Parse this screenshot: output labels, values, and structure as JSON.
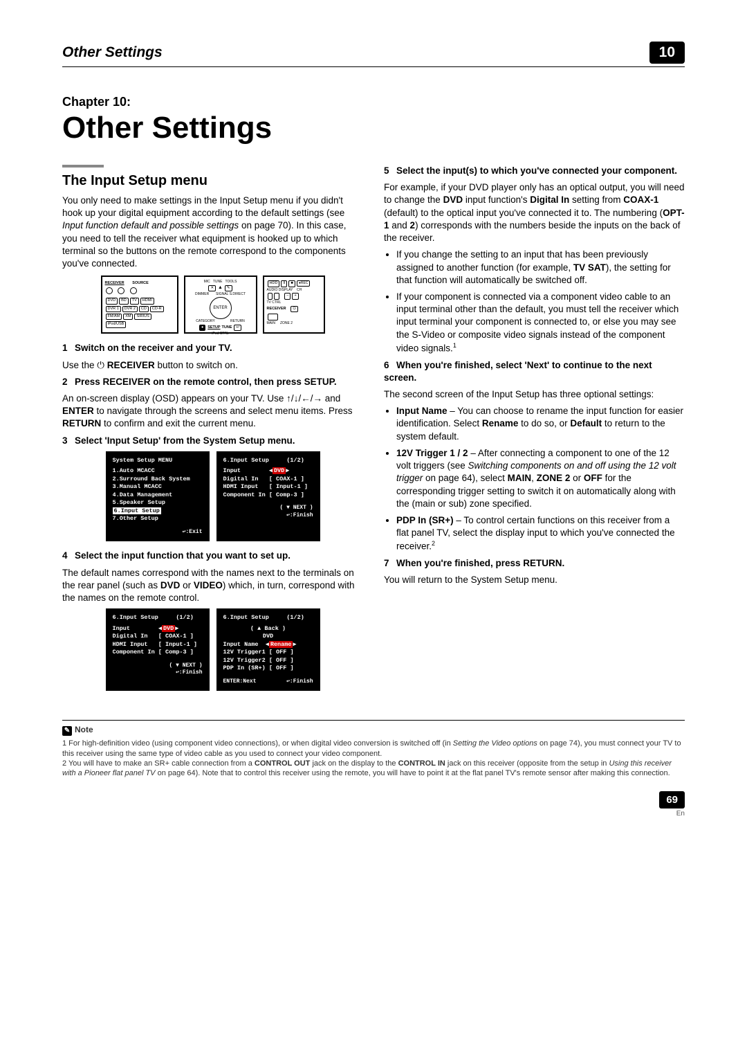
{
  "header": {
    "running_title": "Other Settings",
    "chapter_number": "10"
  },
  "chapter": {
    "label": "Chapter 10:",
    "title": "Other Settings"
  },
  "section_title": "The Input Setup menu",
  "intro": {
    "p1a": "You only need to make settings in the Input Setup menu if you didn't hook up your digital equipment according to the default settings (see ",
    "p1b": "Input function default and possible settings",
    "p1c": " on page 70). In this case, you need to tell the receiver what equipment is hooked up to which terminal so the buttons on the remote correspond to the components you've connected."
  },
  "steps": {
    "s1": "Switch on the receiver and your TV.",
    "s1a": "Use the ",
    "s1b": " RECEIVER",
    "s1c": " button to switch on.",
    "s2": "Press RECEIVER on the remote control, then press SETUP.",
    "s2a": "An on-screen display (OSD) appears on your TV. Use ",
    "s2b": " and ",
    "s2c": "ENTER",
    "s2d": " to navigate through the screens and select menu items. Press ",
    "s2e": "RETURN",
    "s2f": " to confirm and exit the current menu.",
    "s3": "Select 'Input Setup' from the System Setup menu.",
    "s4": "Select the input function that you want to set up.",
    "s4a": "The default names correspond with the names next to the terminals on the rear panel (such as ",
    "s4b": "DVD",
    "s4c": " or ",
    "s4d": "VIDEO",
    "s4e": ") which, in turn, correspond with the names on the remote control.",
    "s5": "Select the input(s) to which you've connected your component.",
    "s5a": "For example, if your DVD player only has an optical output, you will need to change the ",
    "s5b": "DVD",
    "s5c": " input function's ",
    "s5d": "Digital In",
    "s5e": " setting from ",
    "s5f": "COAX-1",
    "s5g": " (default) to the optical input you've connected it to. The numbering (",
    "s5h": "OPT-1",
    "s5i": " and ",
    "s5j": "2",
    "s5k": ") corresponds with the numbers beside the inputs on the back of the receiver.",
    "bul1a": "If you change the setting to an input that has been previously assigned to another function (for example, ",
    "bul1b": "TV SAT",
    "bul1c": "), the setting for that function will automatically be switched off.",
    "bul2": "If your component is connected via a component video cable to an input terminal other than the default, you must tell the receiver which input terminal your component is connected to, or else you may see the S-Video or composite video signals instead of the component video signals.",
    "s6": "When you're finished, select 'Next' to continue to the next screen.",
    "s6a": "The second screen of the Input Setup has three optional settings:",
    "bul3a": "Input Name",
    "bul3b": " – You can choose to rename the input function for easier identification. Select ",
    "bul3c": "Rename",
    "bul3d": " to do so, or ",
    "bul3e": "Default",
    "bul3f": " to return to the system default.",
    "bul4a": "12V Trigger 1 / 2",
    "bul4b": " – After connecting a component to one of the 12 volt triggers (see ",
    "bul4c": "Switching components on and off using the 12 volt trigger",
    "bul4d": " on page 64), select ",
    "bul4e": "MAIN",
    "bul4f": ", ",
    "bul4g": "ZONE 2",
    "bul4h": " or ",
    "bul4i": "OFF",
    "bul4j": " for the corresponding trigger setting to switch it on automatically along with the (main or sub) zone specified.",
    "bul5a": "PDP In (SR+)",
    "bul5b": " – To control certain functions on this receiver from a flat panel TV, select the display input to which you've connected the receiver.",
    "s7": "When you're finished, press RETURN.",
    "s7a": "You will return to the System Setup menu."
  },
  "osd1": {
    "title": "System Setup MENU",
    "items": [
      "1.Auto MCACC",
      "2.Surround Back System",
      "3.Manual MCACC",
      "4.Data Management",
      "5.Speaker Setup",
      "6.Input Setup",
      "7.Other Setup"
    ],
    "foot": ":Exit"
  },
  "osd2": {
    "title": "6.Input Setup",
    "page": "(1/2)",
    "rows": [
      {
        "k": "Input",
        "v": "DVD",
        "hl": true
      },
      {
        "k": "Digital In",
        "v": "COAX-1"
      },
      {
        "k": "HDMI Input",
        "v": "Input-1"
      },
      {
        "k": "Component In",
        "v": "Comp-3"
      }
    ],
    "next": "( ▼ NEXT )",
    "foot": ":Finish"
  },
  "osd3": {
    "title": "6.Input Setup",
    "page": "(1/2)",
    "rows": [
      {
        "k": "Input",
        "v": "DVD",
        "hl": true
      },
      {
        "k": "Digital In",
        "v": "COAX-1"
      },
      {
        "k": "HDMI Input",
        "v": "Input-1"
      },
      {
        "k": "Component In",
        "v": "Comp-3"
      }
    ],
    "next": "( ▼ NEXT )",
    "foot": ":Finish"
  },
  "osd4": {
    "title": "6.Input Setup",
    "page": "(1/2)",
    "back": "( ▲ Back )",
    "dvd": "DVD",
    "rows": [
      {
        "k": "Input Name",
        "v": "Rename",
        "hl": true
      },
      {
        "k": "12V Trigger1",
        "v": "OFF"
      },
      {
        "k": "12V Trigger2",
        "v": "OFF"
      },
      {
        "k": "PDP In (SR+)",
        "v": "OFF"
      }
    ],
    "enter": "ENTER:Next",
    "foot": ":Finish"
  },
  "remote_labels": {
    "receiver": "RECEIVER",
    "source": "SOURCE",
    "dvd": "DVD",
    "bd": "BD",
    "tv": "TV",
    "hdmi": "HDMI",
    "dvr1": "DVR 1",
    "dvr2": "DVR 2",
    "cd": "CD",
    "cdr": "CD-R",
    "fmam": "FM/AM",
    "xm": "XM",
    "sirius": "SIRIUS",
    "ipod": "iPod/USB",
    "enter": "ENTER",
    "setup": "SETUP",
    "return": "RETURN",
    "tune": "TUNE",
    "category": "CATEGORY",
    "st": "ST",
    "dimmer": "DIMMER",
    "signal": "SIGNAL",
    "s": "S.DIRECT",
    "mic": "MIC",
    "tunelabel": "TUNE",
    "toolslabel": "TOOLS",
    "tvctrl": "TV CTRL",
    "audio": "AUDIO",
    "display": "DISPLAY",
    "ch": "CH",
    "rec": "●REC",
    "ipodctrl": "iPod CTRL",
    "receiver2": "RECEIVER",
    "zone2": "ZONE 2",
    "hdd": "HDD",
    "main": "MAIN",
    "dvdlbl": "DVD"
  },
  "note": {
    "label": "Note",
    "n1a": "1 For high-definition video (using component video connections), or when digital video conversion is switched off (in ",
    "n1b": "Setting the Video options",
    "n1c": " on page 74), you must connect your TV to this receiver using the same type of video cable as you used to connect your video component.",
    "n2a": "2 You will have to make an SR+ cable connection from a ",
    "n2b": "CONTROL OUT",
    "n2c": " jack on the display to the ",
    "n2d": "CONTROL IN",
    "n2e": " jack on this receiver (opposite from the setup in ",
    "n2f": "Using this receiver with a Pioneer flat panel TV",
    "n2g": " on page 64). Note that to control this receiver using the remote, you will have to point it at the flat panel TV's remote sensor after making this connection."
  },
  "page_number": "69",
  "page_lang": "En"
}
